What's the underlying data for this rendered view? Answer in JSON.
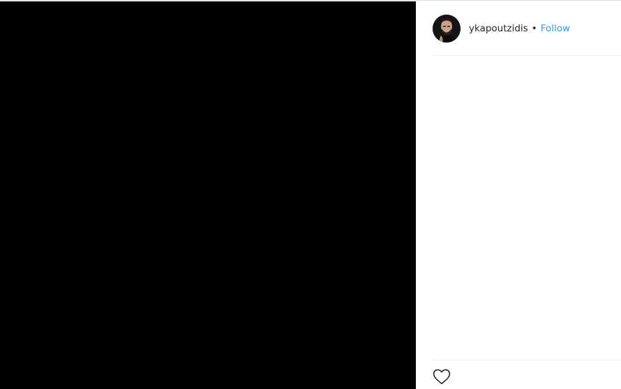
{
  "post": {
    "author": {
      "username": "ykapoutzidis",
      "separator": "•",
      "follow_label": "Follow",
      "avatar_icon": "profile-photo"
    },
    "media": {
      "background": "#000000"
    },
    "actions": {
      "like_icon": "heart-outline-icon"
    }
  },
  "colors": {
    "link": "#3897f0",
    "text": "#262626",
    "divider": "#efefef"
  }
}
